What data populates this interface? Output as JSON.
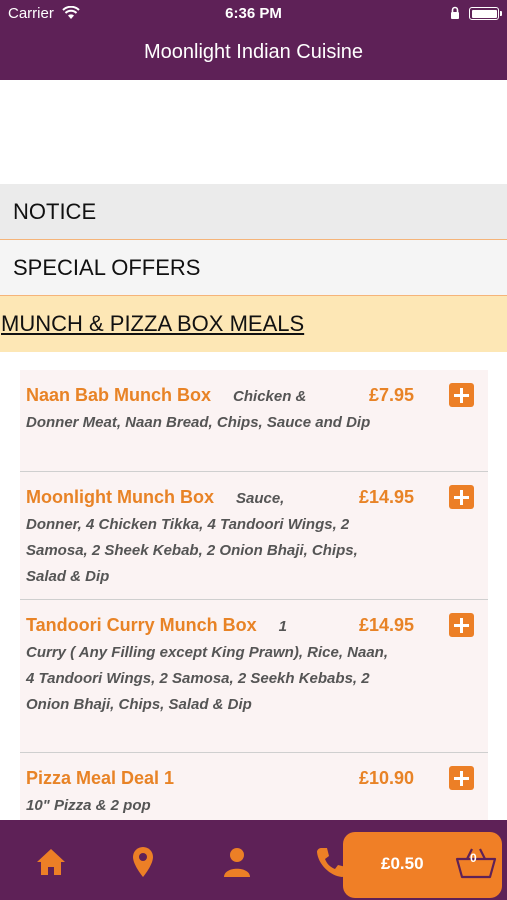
{
  "status_bar": {
    "carrier": "Carrier",
    "time": "6:36 PM"
  },
  "nav": {
    "title": "Moonlight Indian Cuisine"
  },
  "categories": [
    {
      "label": "NOTICE"
    },
    {
      "label": "SPECIAL OFFERS"
    },
    {
      "label": "MUNCH & PIZZA BOX MEALS"
    }
  ],
  "items": [
    {
      "name": "Naan Bab Munch Box",
      "price": "£7.95",
      "desc_lead": "Chicken &",
      "desc": "Donner Meat, Naan Bread, Chips, Sauce and Dip"
    },
    {
      "name": "Moonlight Munch Box",
      "price": "£14.95",
      "desc_lead": "Sauce,",
      "desc": "Donner, 4 Chicken Tikka, 4 Tandoori Wings, 2 Samosa, 2 Sheek Kebab, 2 Onion Bhaji, Chips, Salad & Dip"
    },
    {
      "name": "Tandoori Curry Munch Box",
      "price": "£14.95",
      "desc_lead": "1",
      "desc": "Curry ( Any Filling except King Prawn), Rice, Naan, 4 Tandoori Wings, 2 Samosa, 2 Seekh Kebabs, 2 Onion Bhaji, Chips, Salad & Dip"
    },
    {
      "name": "Pizza Meal Deal 1",
      "price": "£10.90",
      "desc_lead": "",
      "desc": "10\" Pizza & 2 pop"
    }
  ],
  "tab_bar": {
    "icons": [
      "home-icon",
      "location-pin-icon",
      "person-icon",
      "phone-icon"
    ],
    "basket_total": "£0.50",
    "basket_count": "0"
  },
  "colors": {
    "brand_purple": "#5e2157",
    "accent_orange": "#ec7f26",
    "category_highlight": "#fde7b5"
  }
}
